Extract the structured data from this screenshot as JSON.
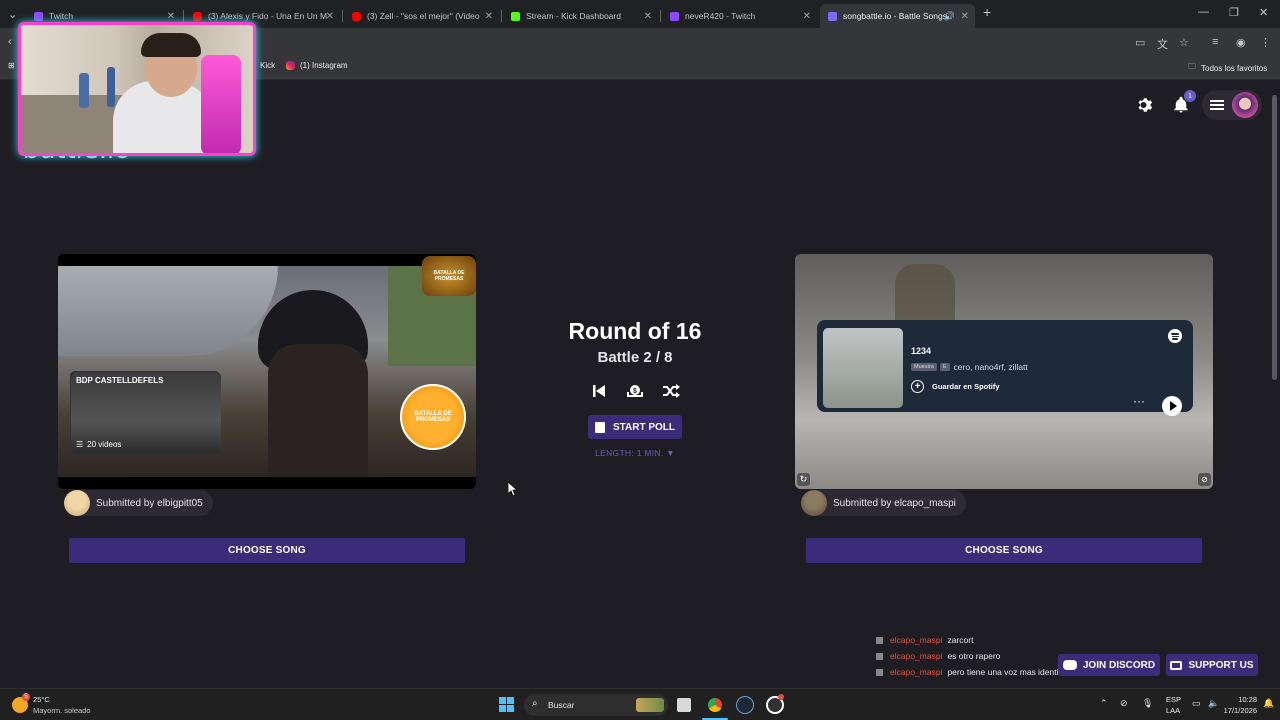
{
  "browser": {
    "tabs": [
      {
        "title": "Twitch",
        "favicon_color": "#9146ff"
      },
      {
        "title": "(3) Alexis y Fido - Una En Un M",
        "favicon_color": "#ff0000"
      },
      {
        "title": "(3) Zell - \"sos el mejor\" (Video",
        "favicon_color": "#ff0000"
      },
      {
        "title": "Stream - Kick Dashboard",
        "favicon_color": "#53fc18"
      },
      {
        "title": "neveR420 - Twitch",
        "favicon_color": "#9146ff"
      },
      {
        "title": "songbattle.io - Battle Songs",
        "favicon_color": "#7b6cff"
      }
    ],
    "bookmarks": [
      {
        "label": "Kick"
      },
      {
        "label": "(1) Instagram"
      }
    ],
    "all_favorites": "Todos los favoritos"
  },
  "header": {
    "logo": "battle.io",
    "notification_count": "1"
  },
  "left_song": {
    "overlay_title": "BDP CASTELLDEFELS",
    "overlay_count": "20 videos",
    "badge_top": "BATALLA DE PROMESAS",
    "badge_main": "BATALLA DE PROMESAS",
    "submitted_by": "Submitted by elbigpitt05",
    "choose_label": "CHOOSE SONG"
  },
  "center": {
    "round": "Round of 16",
    "battle": "Battle 2 / 8",
    "start_poll": "START POLL",
    "length": "LENGTH: 1 MIN. ▼"
  },
  "right_song": {
    "spotify": {
      "track": "1234",
      "tag": "Muestra",
      "explicit": "E",
      "artists": "cero, nano4rf, zillatt",
      "save": "Guardar en Spotify"
    },
    "submitted_by": "Submitted by elcapo_maspi",
    "choose_label": "CHOOSE SONG"
  },
  "chat": [
    {
      "user": "elcapo_maspi",
      "message": "zarcort"
    },
    {
      "user": "elcapo_maspi",
      "message": "es otro rapero"
    },
    {
      "user": "elcapo_maspi",
      "message": "pero tiene una voz mas identificativa"
    }
  ],
  "footer": {
    "discord": "JOIN DISCORD",
    "support": "SUPPORT US"
  },
  "taskbar": {
    "weather_temp": "25°C",
    "weather_desc": "Mayorm. soleado",
    "search": "Buscar",
    "lang": "ESP",
    "lang2": "LAA",
    "time": "10:28",
    "date": "17/1/2026"
  },
  "colors": {
    "accent": "#3b2c7a",
    "page_bg": "#1f1d24",
    "chat_user": "#e0523a",
    "webcam_border": "#ff3fc7"
  }
}
